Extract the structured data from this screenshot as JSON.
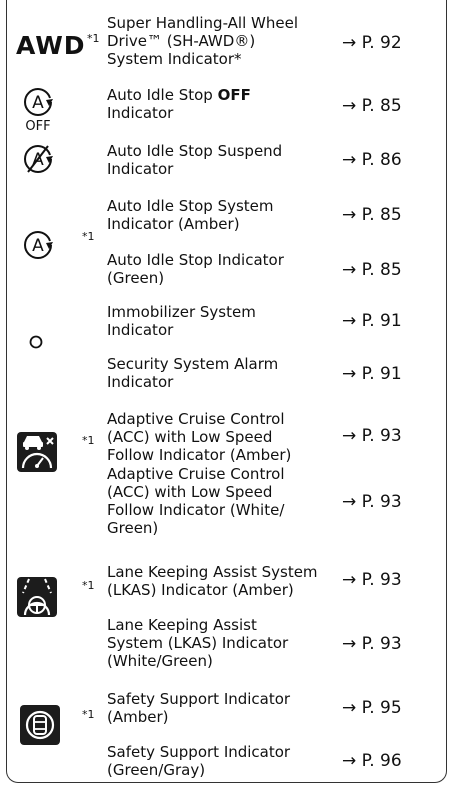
{
  "page_marker": "*1",
  "rows": [
    {
      "text": "Super Handling-All Wheel\nDrive™ (SH-AWD®)\nSystem Indicator*",
      "ref": "→ P. 92"
    },
    {
      "text_pre": "Auto Idle Stop ",
      "text_bold": "OFF",
      "text_post": "\nIndicator",
      "ref": "→ P. 85"
    },
    {
      "text": "Auto Idle Stop Suspend\nIndicator",
      "ref": "→ P. 86"
    },
    {
      "text": "Auto Idle Stop System\nIndicator (Amber)",
      "ref": "→ P. 85"
    },
    {
      "text": "Auto Idle Stop Indicator\n(Green)",
      "ref": "→ P. 85"
    },
    {
      "text": "Immobilizer System\nIndicator",
      "ref": "→ P. 91"
    },
    {
      "text": "Security System Alarm\nIndicator",
      "ref": "→ P. 91"
    },
    {
      "text": "Adaptive Cruise Control\n(ACC) with Low Speed\nFollow Indicator (Amber)",
      "ref": "→ P. 93"
    },
    {
      "text": "Adaptive Cruise Control\n(ACC) with Low Speed\nFollow Indicator (White/\nGreen)",
      "ref": "→ P. 93"
    },
    {
      "text": "Lane Keeping Assist System\n(LKAS) Indicator (Amber)",
      "ref": "→ P. 93"
    },
    {
      "text": "Lane Keeping Assist\nSystem (LKAS) Indicator\n(White/Green)",
      "ref": "→ P. 93"
    },
    {
      "text": "Safety Support Indicator\n(Amber)",
      "ref": "→ P. 95"
    },
    {
      "text": "Safety Support Indicator\n(Green/Gray)",
      "ref": "→ P. 96"
    }
  ],
  "icons": {
    "awd": {
      "label": "AWD",
      "name": "awd-icon"
    },
    "idle_off": {
      "label": "A",
      "sub": "OFF",
      "name": "auto-idle-stop-off-icon"
    },
    "idle_suspend": {
      "label": "A",
      "name": "auto-idle-stop-suspend-icon"
    },
    "idle_system": {
      "label": "A",
      "name": "auto-idle-stop-icon"
    },
    "immobilizer": {
      "name": "immobilizer-icon"
    },
    "acc": {
      "name": "acc-low-speed-follow-icon"
    },
    "lkas": {
      "name": "lkas-icon"
    },
    "safety": {
      "name": "safety-support-icon"
    }
  }
}
